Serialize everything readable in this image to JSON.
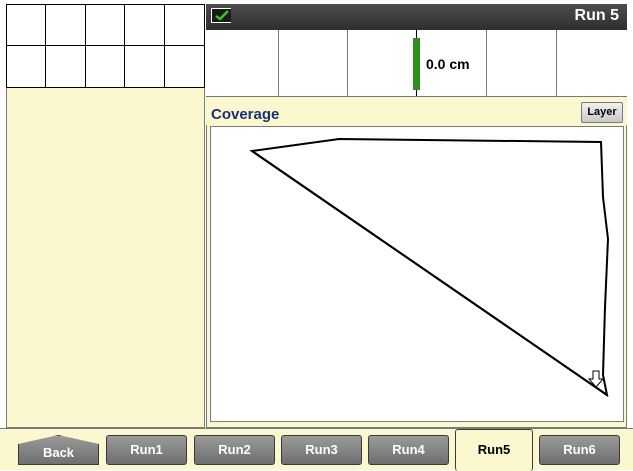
{
  "header": {
    "run_title": "Run 5",
    "status_icon": "check-icon"
  },
  "lightbar": {
    "offset_value": "0.0 cm"
  },
  "coverage": {
    "title": "Coverage",
    "layer_button": "Layer"
  },
  "tabs": [
    {
      "label": "Back"
    },
    {
      "label": "Run1"
    },
    {
      "label": "Run2"
    },
    {
      "label": "Run3"
    },
    {
      "label": "Run4"
    },
    {
      "label": "Run5",
      "active": true
    },
    {
      "label": "Run6"
    }
  ],
  "colors": {
    "panel_background": "#fbf7cf",
    "title_bar": "#3a3a3a",
    "lightbar_indicator": "#2f8f1c",
    "coverage_title": "#1a2f77"
  }
}
